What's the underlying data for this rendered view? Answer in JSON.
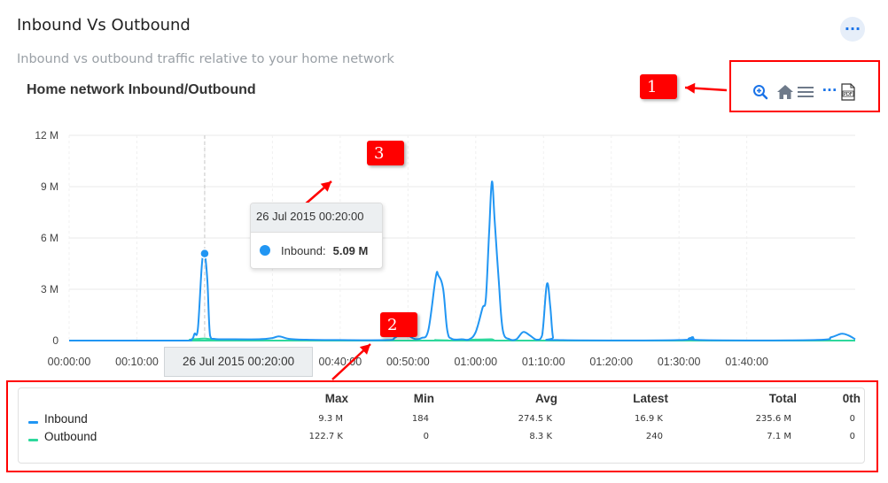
{
  "header": {
    "title": "Inbound Vs Outbound",
    "subtitle": "Inbound vs outbound traffic relative to your home network",
    "more_label": "···"
  },
  "toolbar": {
    "icons": [
      "zoom-in-icon",
      "home-icon",
      "menu-icon",
      "more-icon",
      "pdf-icon"
    ],
    "more_label": "···"
  },
  "callouts": [
    {
      "label": "1"
    },
    {
      "label": "3"
    },
    {
      "label": "2"
    }
  ],
  "tooltip": {
    "header": "26 Jul 2015 00:20:00",
    "series": "Inbound:",
    "value": "5.09 M"
  },
  "crosshair_label": "26 Jul 2015 00:20:00",
  "colors": {
    "inbound": "#2196f3",
    "outbound": "#2ed89c",
    "accent": "#1a73e8",
    "annotation": "#ff0000"
  },
  "chart_data": {
    "type": "line",
    "title": "Home network Inbound/Outbound",
    "xlabel": "",
    "ylabel": "",
    "yticks": [
      "0",
      "3 M",
      "6 M",
      "9 M",
      "12 M"
    ],
    "ylim": [
      0,
      12000000
    ],
    "xticks": [
      "00:00:00",
      "00:10:00",
      "00:20:00",
      "00:30:00",
      "00:40:00",
      "00:50:00",
      "01:00:00",
      "01:10:00",
      "01:20:00",
      "01:30:00",
      "01:40:00"
    ],
    "x_range_minutes": [
      0,
      116
    ],
    "grid": true,
    "series": [
      {
        "name": "Inbound",
        "points": [
          [
            0,
            0
          ],
          [
            16,
            0
          ],
          [
            18,
            50000
          ],
          [
            18.5,
            400000
          ],
          [
            19,
            700000
          ],
          [
            19.6,
            4500000
          ],
          [
            20,
            5090000
          ],
          [
            20.4,
            3500000
          ],
          [
            20.8,
            300000
          ],
          [
            21.5,
            100000
          ],
          [
            23,
            80000
          ],
          [
            28,
            80000
          ],
          [
            30,
            150000
          ],
          [
            31,
            250000
          ],
          [
            32.5,
            100000
          ],
          [
            35,
            50000
          ],
          [
            40,
            30000
          ],
          [
            47,
            30000
          ],
          [
            48,
            150000
          ],
          [
            49,
            400000
          ],
          [
            50,
            300000
          ],
          [
            51,
            100000
          ],
          [
            52,
            150000
          ],
          [
            53,
            600000
          ],
          [
            54.1,
            3700000
          ],
          [
            54.5,
            3800000
          ],
          [
            55.2,
            3000000
          ],
          [
            55.8,
            600000
          ],
          [
            56.5,
            100000
          ],
          [
            58,
            80000
          ],
          [
            59,
            60000
          ],
          [
            60,
            500000
          ],
          [
            61,
            1900000
          ],
          [
            61.5,
            2500000
          ],
          [
            62,
            6500000
          ],
          [
            62.4,
            9300000
          ],
          [
            62.8,
            7000000
          ],
          [
            63.4,
            3500000
          ],
          [
            64,
            600000
          ],
          [
            65,
            80000
          ],
          [
            66,
            80000
          ],
          [
            67,
            500000
          ],
          [
            68,
            300000
          ],
          [
            69,
            50000
          ],
          [
            69.8,
            300000
          ],
          [
            70.5,
            3300000
          ],
          [
            71,
            2000000
          ],
          [
            71.4,
            200000
          ],
          [
            72,
            30000
          ],
          [
            90,
            30000
          ],
          [
            92,
            200000
          ],
          [
            93,
            30000
          ],
          [
            110,
            30000
          ],
          [
            112.5,
            200000
          ],
          [
            114,
            400000
          ],
          [
            115,
            300000
          ],
          [
            116,
            80000
          ]
        ]
      },
      {
        "name": "Outbound",
        "points": [
          [
            0,
            0
          ],
          [
            19.5,
            0
          ],
          [
            20,
            122700
          ],
          [
            20.5,
            0
          ],
          [
            53,
            0
          ],
          [
            54,
            30000
          ],
          [
            55,
            0
          ],
          [
            62,
            0
          ],
          [
            62.4,
            80000
          ],
          [
            63,
            0
          ],
          [
            116,
            0
          ]
        ]
      }
    ],
    "table": {
      "columns": [
        "Max",
        "Min",
        "Avg",
        "Latest",
        "Total",
        "0th"
      ],
      "rows": [
        {
          "name": "Inbound",
          "values": [
            "9.3 M",
            "184",
            "274.5 K",
            "16.9 K",
            "235.6 M",
            "0"
          ]
        },
        {
          "name": "Outbound",
          "values": [
            "122.7 K",
            "0",
            "8.3 K",
            "240",
            "7.1 M",
            "0"
          ]
        }
      ]
    }
  }
}
